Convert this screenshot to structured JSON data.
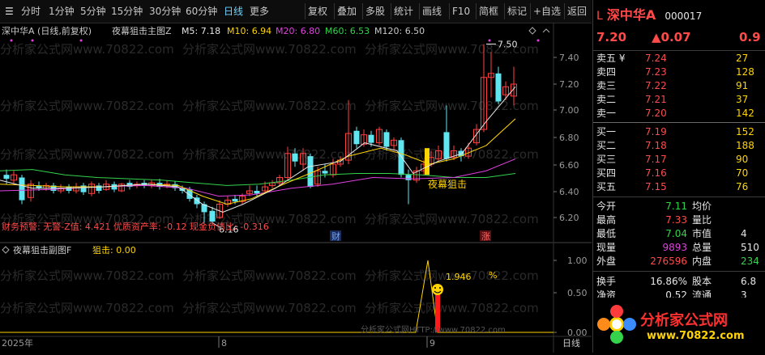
{
  "toolbar": {
    "left_items": [
      "分时",
      "1分钟",
      "5分钟",
      "15分钟",
      "30分钟",
      "60分钟",
      "日线",
      "更多"
    ],
    "active": "日线",
    "right_items": [
      "复权",
      "叠加",
      "多股",
      "统计",
      "画线",
      "F10",
      "简框",
      "标记",
      "+自选",
      "返回"
    ]
  },
  "main_chart": {
    "title": "深中华A (日线,前复权)",
    "indicator": "夜幕狙击主图Z",
    "ma": [
      {
        "label": "M5: 7.18",
        "color": "#e6e6e6"
      },
      {
        "label": "M10: 6.94",
        "color": "#ffd400"
      },
      {
        "label": "M20: 6.80",
        "color": "#e040e0"
      },
      {
        "label": "M60: 6.53",
        "color": "#34d34b"
      },
      {
        "label": "M120: 6.50",
        "color": "#c8c8c8"
      }
    ],
    "price_axis": [
      "7.40",
      "7.20",
      "7.00",
      "6.80",
      "6.60",
      "6.40",
      "6.20"
    ],
    "high_label": "7.50",
    "low_label": "6.16",
    "signal_label": "夜幕狙击",
    "finance_warning": "财务预警: 无警-Z值: 4.421 优质资产率: -0.12 现金负债比: -0.316",
    "marks": [
      "财",
      "涨"
    ]
  },
  "sub_chart": {
    "title": "夜幕狙击副图F",
    "value_label": "狙击: 0.00",
    "axis": [
      "1.00",
      "0.50",
      "0.00"
    ],
    "peak_label": "1.946",
    "pct_label": "%"
  },
  "time_axis": {
    "labels": [
      "2025年",
      "8",
      "9"
    ],
    "period": "日线"
  },
  "watermark": {
    "text": "分析家公式网www.70822.com",
    "footer": "分析家公式网HTTP://www.70822.com"
  },
  "quote": {
    "name": "深中华A",
    "code": "000017",
    "price": "7.20",
    "change": "▲0.07",
    "pct": "0.9",
    "sell": [
      {
        "label": "卖五 ¥",
        "price": "7.24",
        "vol": "27"
      },
      {
        "label": "卖四",
        "price": "7.23",
        "vol": "128"
      },
      {
        "label": "卖三",
        "price": "7.22",
        "vol": "91"
      },
      {
        "label": "卖二",
        "price": "7.21",
        "vol": "37"
      },
      {
        "label": "卖一",
        "price": "7.20",
        "vol": "142"
      }
    ],
    "buy": [
      {
        "label": "买一",
        "price": "7.19",
        "vol": "152"
      },
      {
        "label": "买二",
        "price": "7.18",
        "vol": "188"
      },
      {
        "label": "买三",
        "price": "7.17",
        "vol": "90"
      },
      {
        "label": "买四",
        "price": "7.16",
        "vol": "70"
      },
      {
        "label": "买五",
        "price": "7.15",
        "vol": "76"
      }
    ],
    "stats": [
      {
        "l1": "今开",
        "v1": "7.11",
        "c1": "green",
        "l2": "均价",
        "v2": "",
        "c2": "white"
      },
      {
        "l1": "最高",
        "v1": "7.33",
        "c1": "red",
        "l2": "量比",
        "v2": "",
        "c2": "white"
      },
      {
        "l1": "最低",
        "v1": "7.04",
        "c1": "green",
        "l2": "市值",
        "v2": "4",
        "c2": "white"
      },
      {
        "l1": "现量",
        "v1": "9893",
        "c1": "magenta",
        "l2": "总量",
        "v2": "510",
        "c2": "white"
      },
      {
        "l1": "外盘",
        "v1": "276596",
        "c1": "red",
        "l2": "内盘",
        "v2": "234",
        "c2": "green"
      },
      {
        "l1": "换手",
        "v1": "16.86%",
        "c1": "white",
        "l2": "股本",
        "v2": "6.8",
        "c2": "white"
      },
      {
        "l1": "净资",
        "v1": "0.52",
        "c1": "white",
        "l2": "流通",
        "v2": "3",
        "c2": "white"
      }
    ],
    "logo_text": "分析家公式网",
    "logo_url": "www.70822.com"
  }
}
